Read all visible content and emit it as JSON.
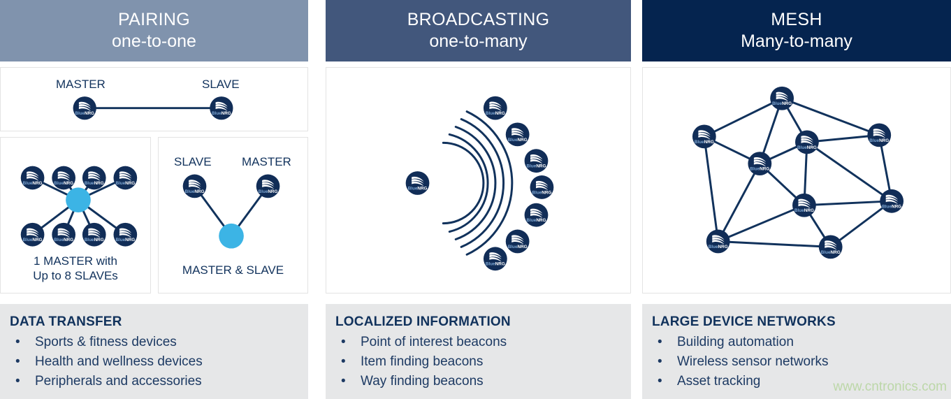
{
  "columns": [
    {
      "key": "pairing",
      "header": {
        "title": "PAIRING",
        "subtitle": "one-to-one",
        "bg": "#8093ad"
      },
      "diagram": {
        "top_box": {
          "labels": [
            {
              "text": "MASTER"
            },
            {
              "text": "SLAVE"
            }
          ]
        },
        "left_box": {
          "caption_line1": "1 MASTER with",
          "caption_line2": "Up to 8 SLAVEs",
          "node_count": 8,
          "hub_color": "#3cb4e5"
        },
        "right_box": {
          "labels": [
            {
              "text": "SLAVE"
            },
            {
              "text": "MASTER"
            }
          ],
          "caption": "MASTER & SLAVE",
          "node_count": 2,
          "hub_color": "#3cb4e5"
        }
      },
      "info": {
        "title": "DATA TRANSFER",
        "bullet": "•",
        "items": [
          "Sports & fitness devices",
          "Health and wellness devices",
          "Peripherals and accessories"
        ]
      }
    },
    {
      "key": "broadcasting",
      "header": {
        "title": "BROADCASTING",
        "subtitle": "one-to-many",
        "bg": "#42577c"
      },
      "diagram": {
        "transmitter_count": 1,
        "arc_count": 5,
        "receiver_count": 7
      },
      "info": {
        "title": "LOCALIZED INFORMATION",
        "bullet": "•",
        "items": [
          "Point of interest beacons",
          "Item finding beacons",
          "Way finding beacons"
        ]
      }
    },
    {
      "key": "mesh",
      "header": {
        "title": "MESH",
        "subtitle": "Many-to-many",
        "bg": "#05244f"
      },
      "diagram": {
        "node_count": 9,
        "link_count": 18
      },
      "info": {
        "title": "LARGE DEVICE NETWORKS",
        "bullet": "•",
        "items": [
          "Building automation",
          "Wireless sensor networks",
          "Asset tracking"
        ]
      }
    }
  ],
  "node": {
    "logo_name": "bluenrg-wing-icon",
    "label_blue": "Blue",
    "label_nrg": "NRG",
    "circle_color": "#112d57"
  },
  "watermark": {
    "text": "www.cntronics.com",
    "color": "#bcd7a8"
  }
}
